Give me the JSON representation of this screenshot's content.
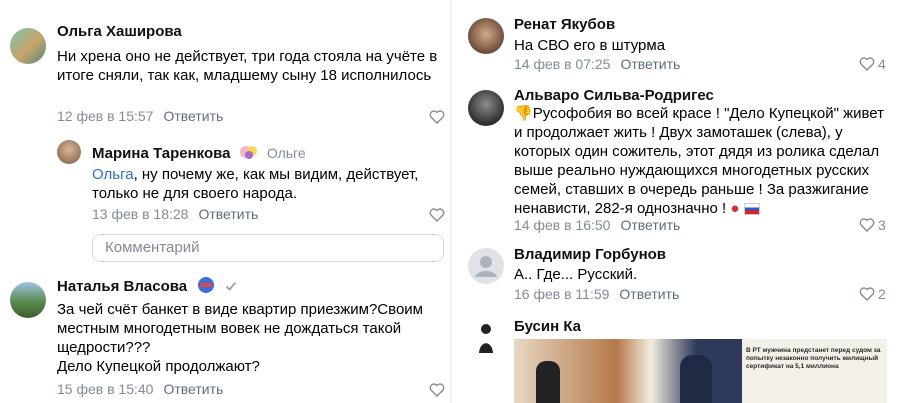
{
  "left": {
    "c1": {
      "name": "Ольга Хаширова",
      "text": "Ни хрена оно не действует, три года стояла на учёте в итоге сняли, так как, младшему сыну 18 исполнилось",
      "date": "12 фев в 15:57",
      "reply": "Ответить"
    },
    "c2": {
      "name": "Марина Таренкова",
      "to": "Ольге",
      "mention": "Ольга",
      "text": ", ну почему же, как мы  видим, действует, только не для своего народа.",
      "date": "13 фев в 18:28",
      "reply": "Ответить"
    },
    "comment_placeholder": "Комментарий",
    "c3": {
      "name": "Наталья Власова",
      "text": "За чей счёт банкет в виде квартир приезжим?Своим местным многодетным вовек не дождаться такой щедрости???\nДело Купецкой продолжают?",
      "date": "15 фев в 15:40",
      "reply": "Ответить"
    }
  },
  "right": {
    "c1": {
      "name": "Ренат Якубов",
      "text": "На СВО его в штурма",
      "date": "14 фев в 07:25",
      "reply": "Ответить",
      "likes": "4"
    },
    "c2": {
      "name": "Альваро Сильва-Родригес",
      "text": "Русофобия во всей красе ! \"Дело Купецкой\" живет и продолжает жить ! Двух замоташек (слева), у которых один сожитель, этот дядя из ролика сделал выше реально нуждающихся многодетных русских семей, ставших в очередь раньше ! За разжигание ненависти, 282-я однозначно !",
      "date": "14 фев в 16:50",
      "reply": "Ответить",
      "likes": "3"
    },
    "c3": {
      "name": "Владимир Горбунов",
      "text": "А.. Где... Русский.",
      "date": "16 фев в 11:59",
      "reply": "Ответить",
      "likes": "2"
    },
    "c4": {
      "name": "Бусин Ка",
      "image_headline": "В РТ мужчина предстанет перед судом за попытку незаконно получить жилищный сертификат на 5,1 миллиона"
    }
  },
  "colors": {
    "link": "#2a6fd4",
    "meta": "#818c99",
    "reply": "#5d6d82"
  }
}
